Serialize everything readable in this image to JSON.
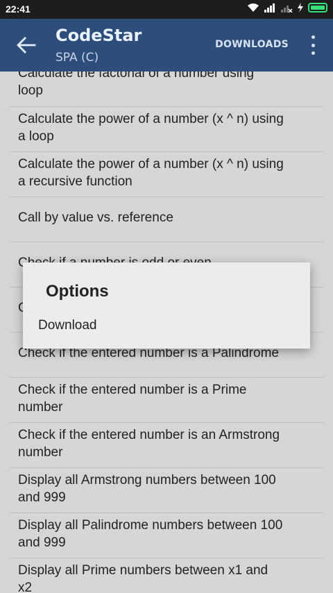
{
  "status_bar": {
    "time": "22:41"
  },
  "app_bar": {
    "title": "CodeStar",
    "subtitle": "SPA (C)",
    "downloads_label": "DOWNLOADS"
  },
  "list": {
    "items": [
      {
        "line1": "Calculate the factorial of a number using",
        "line2": "loop"
      },
      {
        "line1": "Calculate the power of a number (x ^ n) using",
        "line2": "a loop"
      },
      {
        "line1": "Calculate the power of a number (x ^ n) using",
        "line2": "a recursive function"
      },
      {
        "line1": "Call by value vs. reference",
        "line2": ""
      },
      {
        "line1": "Check if a number is odd or even",
        "line2": ""
      },
      {
        "line1": "C",
        "line2": ""
      },
      {
        "line1": "Check if the entered number is a Palindrome",
        "line2": ""
      },
      {
        "line1": "Check if the entered number is a Prime",
        "line2": "number"
      },
      {
        "line1": "Check if the entered number is an Armstrong",
        "line2": "number"
      },
      {
        "line1": "Display all Armstrong numbers between 100",
        "line2": "and 999"
      },
      {
        "line1": "Display all Palindrome numbers between 100",
        "line2": "and 999"
      },
      {
        "line1": "Display all Prime numbers between x1 and",
        "line2": "x2"
      }
    ]
  },
  "dialog": {
    "title": "Options",
    "option": "Download"
  },
  "colors": {
    "app_bar": "#2d4d7a",
    "list_bg": "#d6d6d6",
    "dialog_bg": "#ececec",
    "battery": "#36e07a"
  }
}
